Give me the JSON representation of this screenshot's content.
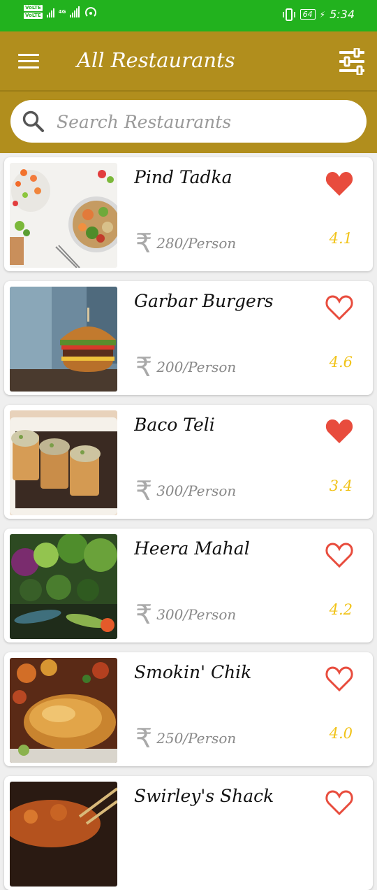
{
  "status_bar": {
    "volte_1": "VoLTE",
    "volte_2": "VoLTE",
    "network": "4G",
    "battery": "64",
    "time": "5:34"
  },
  "app_bar": {
    "title": "All Restaurants",
    "menu_icon": "hamburger-menu-icon",
    "filter_icon": "filter-sliders-icon"
  },
  "search": {
    "placeholder": "Search Restaurants",
    "value": ""
  },
  "colors": {
    "status_bar": "#22b21e",
    "app_bar": "#b18e1d",
    "heart": "#e84c3d",
    "rating": "#f1c319"
  },
  "restaurants": [
    {
      "name": "Pind Tadka",
      "price": "280/Person",
      "rating": "4.1",
      "favorite": true,
      "image": "salad-bowl"
    },
    {
      "name": "Garbar Burgers",
      "price": "200/Person",
      "rating": "4.6",
      "favorite": false,
      "image": "burger"
    },
    {
      "name": "Baco Teli",
      "price": "300/Person",
      "rating": "3.4",
      "favorite": true,
      "image": "tacos"
    },
    {
      "name": "Heera Mahal",
      "price": "300/Person",
      "rating": "4.2",
      "favorite": false,
      "image": "vegetables"
    },
    {
      "name": "Smokin' Chik",
      "price": "250/Person",
      "rating": "4.0",
      "favorite": false,
      "image": "roast-chicken"
    },
    {
      "name": "Swirley's Shack",
      "price": "",
      "rating": "",
      "favorite": false,
      "image": "skewers"
    }
  ]
}
